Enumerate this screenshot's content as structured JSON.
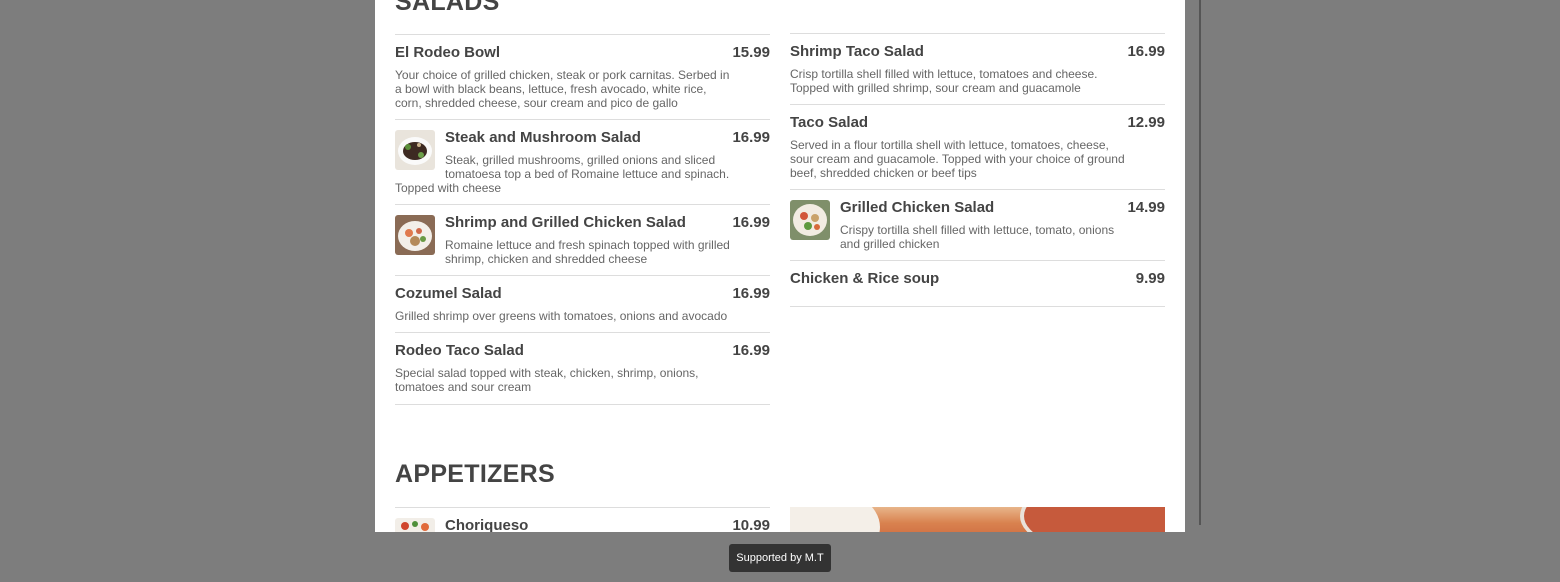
{
  "salads": {
    "title": "SALADS",
    "left": [
      {
        "name": "El Rodeo Bowl",
        "price": "15.99",
        "desc": "Your choice of grilled chicken, steak or pork carnitas. Serbed in a bowl with black beans, lettuce, fresh avocado, white rice, corn, shredded cheese, sour cream and pico de gallo"
      },
      {
        "name": "Steak and Mushroom Salad",
        "price": "16.99",
        "desc_line1": "Steak, grilled mushrooms, grilled onions and sliced tomatoesa top a bed of Romaine lettuce and spinach.",
        "desc_line2": "Topped with cheese"
      },
      {
        "name": "Shrimp and Grilled Chicken Salad",
        "price": "16.99",
        "desc": "Romaine lettuce and fresh spinach topped with grilled shrimp, chicken and shredded cheese"
      },
      {
        "name": "Cozumel Salad",
        "price": "16.99",
        "desc": "Grilled shrimp over greens with tomatoes, onions and avocado"
      },
      {
        "name": "Rodeo Taco Salad",
        "price": "16.99",
        "desc": "Special salad topped with steak, chicken, shrimp, onions, tomatoes and sour cream"
      }
    ],
    "right": [
      {
        "name": "Shrimp Taco Salad",
        "price": "16.99",
        "desc": "Crisp tortilla shell filled with lettuce, tomatoes and cheese. Topped with grilled shrimp, sour cream and guacamole"
      },
      {
        "name": "Taco Salad",
        "price": "12.99",
        "desc": "Served in a flour tortilla shell with lettuce, tomatoes, cheese, sour cream and guacamole. Topped with your choice of ground beef, shredded chicken or beef tips"
      },
      {
        "name": "Grilled Chicken Salad",
        "price": "14.99",
        "desc": "Crispy tortilla shell filled with lettuce, tomato, onions and grilled chicken"
      },
      {
        "name": "Chicken & Rice soup",
        "price": "9.99"
      }
    ]
  },
  "appetizers": {
    "title": "APPETIZERS",
    "left": [
      {
        "name": "Choriqueso",
        "price": "10.99"
      }
    ]
  },
  "footer": {
    "toast": "Supported by M.T"
  }
}
